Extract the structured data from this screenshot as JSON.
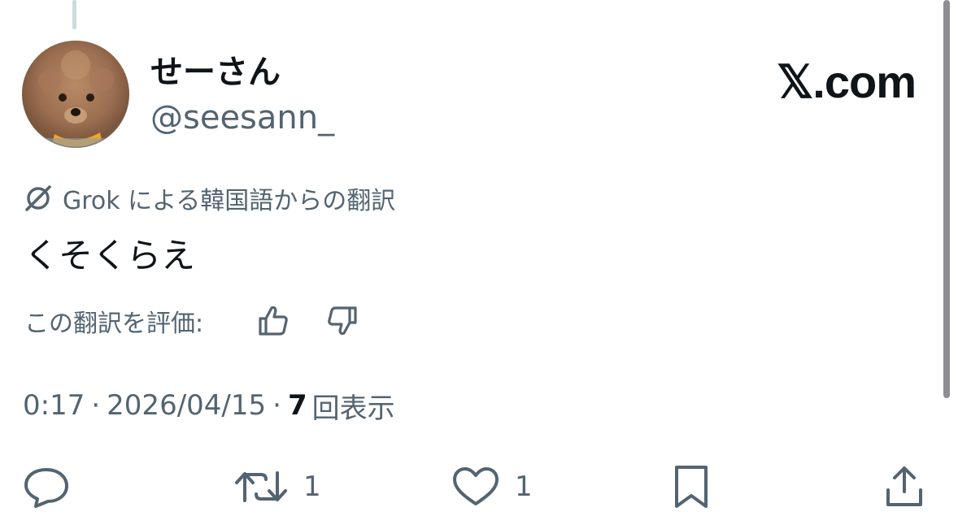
{
  "post": {
    "display_name": "せーさん",
    "handle": "@seesann_",
    "brand": "𝕏.com",
    "translation_note": "Grok による韓国語からの翻訳",
    "text": "くそくらえ",
    "rate_label": "この翻訳を評価:",
    "time": "0:17",
    "separator": "·",
    "date": "2026/04/15",
    "views_count": "7",
    "views_label": "回表示"
  },
  "actions": {
    "reply_icon": "speech-bubble-icon",
    "retweet_icon": "retweet-icon",
    "retweet_count": "1",
    "like_icon": "heart-icon",
    "like_count": "1",
    "bookmark_icon": "bookmark-icon",
    "share_icon": "share-icon"
  },
  "colors": {
    "text_primary": "#0f1419",
    "text_secondary": "#536471",
    "thread_line": "#cfd9de",
    "scrollbar": "#8e8e93"
  }
}
